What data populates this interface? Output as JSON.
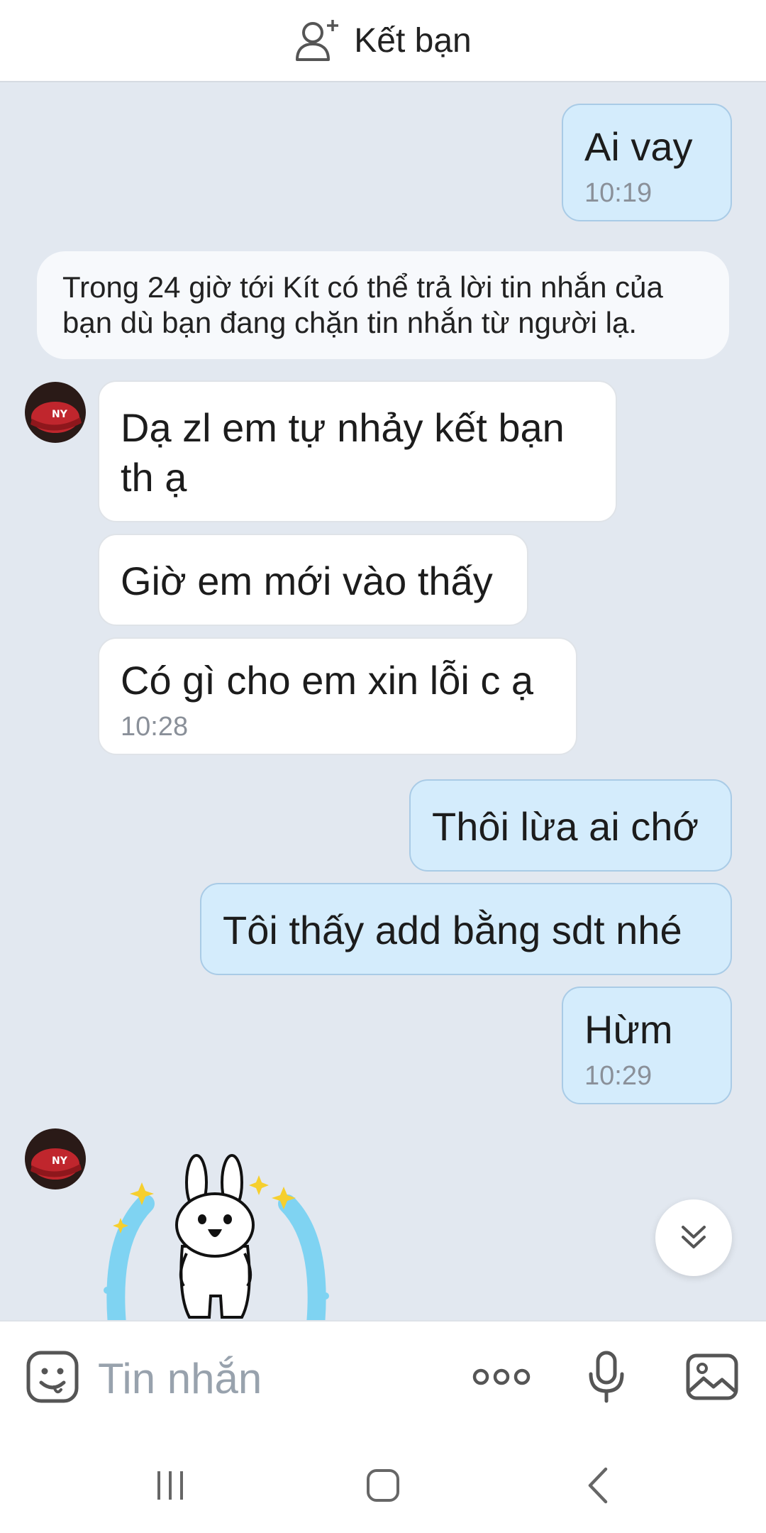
{
  "header": {
    "add_friend_label": "Kết bạn",
    "icon": "add-person-icon"
  },
  "notice": {
    "text": "Trong 24 giờ tới Kít có thể trả lời tin nhắn của bạn dù bạn đang chặn tin nhắn từ người lạ."
  },
  "messages": [
    {
      "sender": "me",
      "text": "Ai vay",
      "time": "10:19"
    },
    {
      "sender": "them",
      "text": "Dạ zl em tự nhảy kết bạn th ạ"
    },
    {
      "sender": "them",
      "text": "Giờ em mới vào thấy"
    },
    {
      "sender": "them",
      "text": "Có gì cho em xin lỗi c ạ",
      "time": "10:28"
    },
    {
      "sender": "me",
      "text": "Thôi lừa ai chớ"
    },
    {
      "sender": "me",
      "text": "Tôi thấy add bằng sdt nhé"
    },
    {
      "sender": "me",
      "text": "Hừm",
      "time": "10:29"
    }
  ],
  "composer": {
    "placeholder": "Tin nhắn",
    "icons": [
      "emoji-sticker-icon",
      "more-options-icon",
      "microphone-icon",
      "image-gallery-icon"
    ]
  },
  "navigation": {
    "icons": [
      "recent-apps-icon",
      "home-icon",
      "back-icon"
    ]
  },
  "colors": {
    "chat_background": "#e2e8f0",
    "my_bubble": "#d4ecfc",
    "their_bubble": "#ffffff",
    "timestamp": "#8a9099",
    "avatar_cap": "#c0262d"
  }
}
